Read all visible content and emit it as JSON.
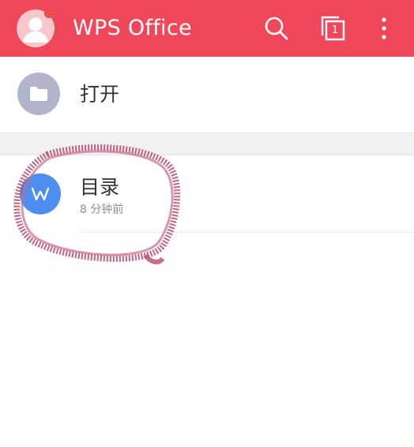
{
  "appbar": {
    "title": "WPS Office",
    "bg_color": "#f0485a",
    "avatar_icon": "user-avatar-icon",
    "notification_dot_color": "#e6533b",
    "search_icon": "search-icon",
    "windows_icon": "window-switch-icon",
    "windows_count": "1",
    "more_icon": "more-vertical-icon"
  },
  "open_row": {
    "label": "打开",
    "icon": "folder-icon",
    "icon_bg": "#b2b5c9"
  },
  "recent": {
    "items": [
      {
        "name": "目录",
        "time": "8 分钟前",
        "icon": "wps-writer-icon",
        "icon_bg": "#4d8ef0"
      }
    ]
  },
  "annotation": {
    "type": "hand-drawn-circle",
    "color": "#b84a6a"
  }
}
